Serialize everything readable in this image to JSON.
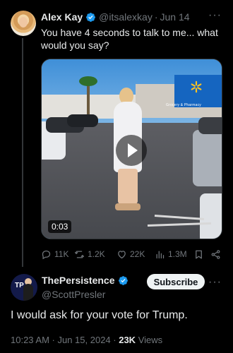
{
  "tweet1": {
    "author_name": "Alex Kay",
    "handle": "@itsalexkay",
    "separator": "·",
    "date": "Jun 14",
    "text": "You have 4 seconds to talk to me... what would you say?",
    "video": {
      "duration": "0:03",
      "store_sign": "Grocery & Pharmacy"
    },
    "actions": {
      "replies": "11K",
      "reposts": "1.2K",
      "likes": "22K",
      "views": "1.3M"
    }
  },
  "tweet2": {
    "author_name": "ThePersistence",
    "handle": "@ScottPresler",
    "subscribe_label": "Subscribe",
    "text": "I would ask for your vote for Trump.",
    "timestamp": "10:23 AM · Jun 15, 2024 · ",
    "views_count": "23K",
    "views_label": " Views",
    "avatar_text": "TP"
  },
  "more_glyph": "···",
  "colors": {
    "verified": "#1d9bf0",
    "muted": "#71767b",
    "background": "#000000"
  }
}
